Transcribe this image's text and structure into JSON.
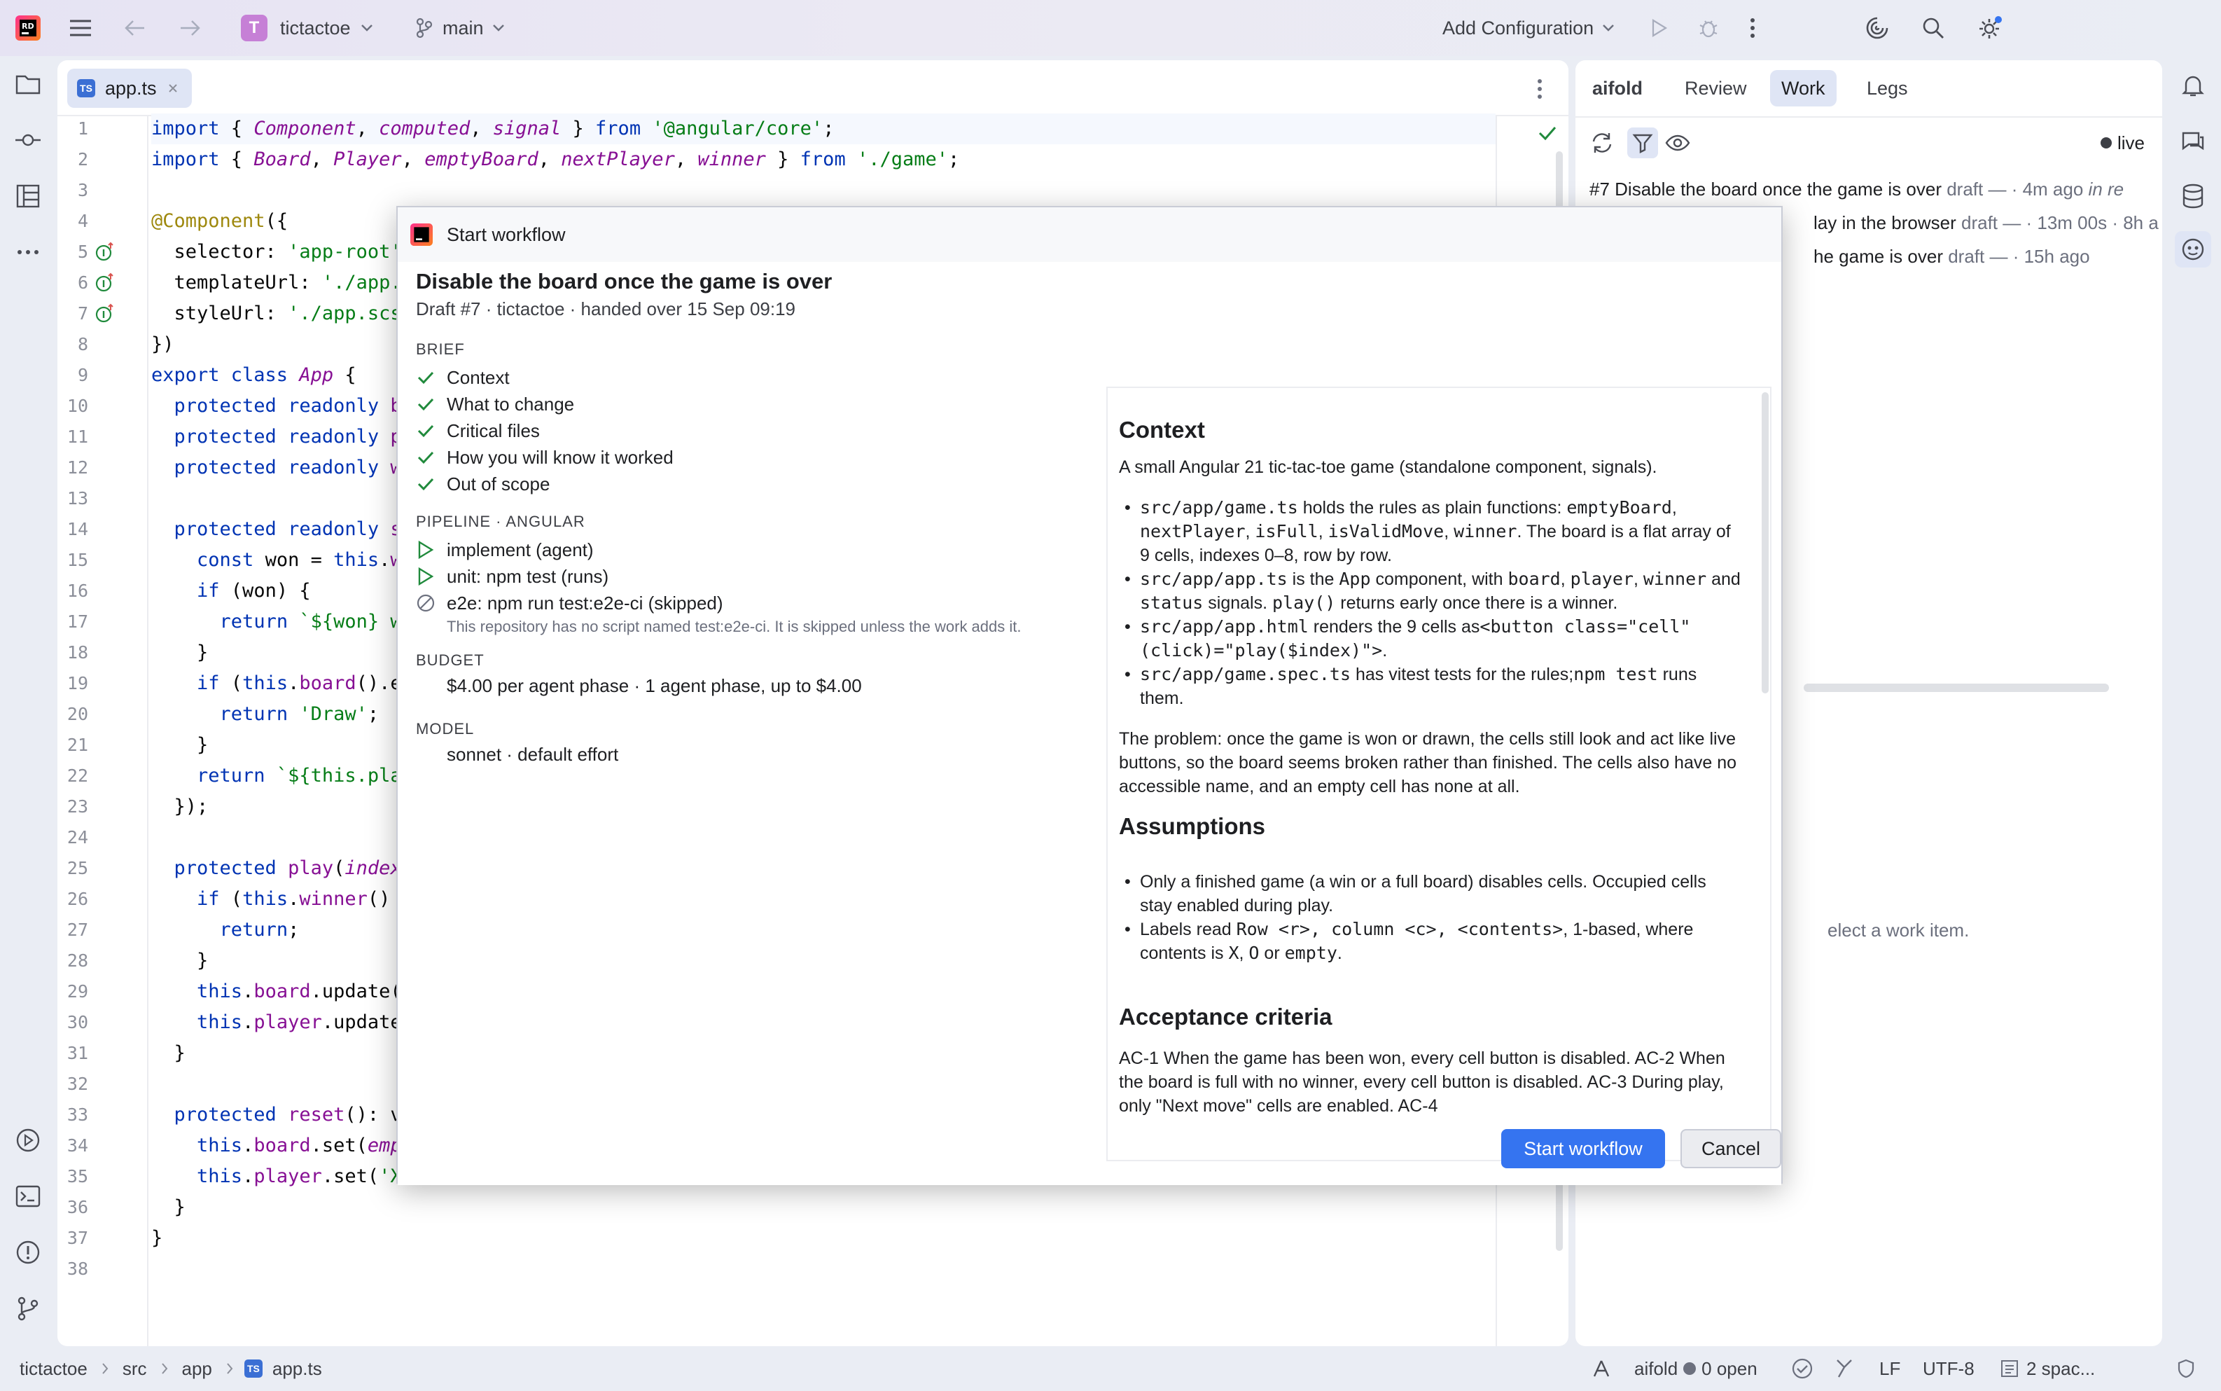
{
  "titlebar": {
    "project_initial": "T",
    "project_name": "tictactoe",
    "branch": "main",
    "run_config": "Add Configuration"
  },
  "editor": {
    "tab_name": "app.ts",
    "lines": [
      {
        "n": "1",
        "html": "<span class='kw'>import</span> { <span class='typ'>Component</span>, <span class='typ'>computed</span>, <span class='typ'>signal</span> } <span class='kw'>from</span> <span class='str'>'@angular/core'</span>;"
      },
      {
        "n": "2",
        "html": "<span class='kw'>import</span> { <span class='typ'>Board</span>, <span class='typ'>Player</span>, <span class='typ'>emptyBoard</span>, <span class='typ'>nextPlayer</span>, <span class='typ'>winner</span> } <span class='kw'>from</span> <span class='str'>'./game'</span>;"
      },
      {
        "n": "3",
        "html": ""
      },
      {
        "n": "4",
        "html": "<span class='ann'>@Component</span>({"
      },
      {
        "n": "5",
        "html": "  selector: <span class='str'>'app-root'</span>,"
      },
      {
        "n": "6",
        "html": "  templateUrl: <span class='str'>'./app.html'</span>,"
      },
      {
        "n": "7",
        "html": "  styleUrl: <span class='str'>'./app.scss'</span>"
      },
      {
        "n": "8",
        "html": "})"
      },
      {
        "n": "9",
        "html": "<span class='kw'>export class</span> <span class='typ'>App</span> {"
      },
      {
        "n": "10",
        "html": "  <span class='kw'>protected readonly</span> <span class='prop'>board</span>"
      },
      {
        "n": "11",
        "html": "  <span class='kw'>protected readonly</span> <span class='prop'>player</span>"
      },
      {
        "n": "12",
        "html": "  <span class='kw'>protected readonly</span> <span class='prop'>winner</span>"
      },
      {
        "n": "13",
        "html": ""
      },
      {
        "n": "14",
        "html": "  <span class='kw'>protected readonly</span> <span class='prop'>status</span>"
      },
      {
        "n": "15",
        "html": "    <span class='kw'>const</span> won = <span class='kw'>this</span>.<span class='prop'>winner</span>();"
      },
      {
        "n": "16",
        "html": "    <span class='kw'>if</span> (won) {"
      },
      {
        "n": "17",
        "html": "      <span class='kw'>return</span> <span class='str'>`${won} wins`</span>;"
      },
      {
        "n": "18",
        "html": "    }"
      },
      {
        "n": "19",
        "html": "    <span class='kw'>if</span> (<span class='kw'>this</span>.<span class='prop'>board</span>().every"
      },
      {
        "n": "20",
        "html": "      <span class='kw'>return</span> <span class='str'>'Draw'</span>;"
      },
      {
        "n": "21",
        "html": "    }"
      },
      {
        "n": "22",
        "html": "    <span class='kw'>return</span> <span class='str'>`${this.player()}`</span>"
      },
      {
        "n": "23",
        "html": "  });"
      },
      {
        "n": "24",
        "html": ""
      },
      {
        "n": "25",
        "html": "  <span class='kw'>protected</span> <span class='prop'>play</span>(<span class='typ'>index</span>"
      },
      {
        "n": "26",
        "html": "    <span class='kw'>if</span> (<span class='kw'>this</span>.<span class='prop'>winner</span>()"
      },
      {
        "n": "27",
        "html": "      <span class='kw'>return</span>;"
      },
      {
        "n": "28",
        "html": "    }"
      },
      {
        "n": "29",
        "html": "    <span class='kw'>this</span>.<span class='prop'>board</span>.update("
      },
      {
        "n": "30",
        "html": "    <span class='kw'>this</span>.<span class='prop'>player</span>.update"
      },
      {
        "n": "31",
        "html": "  }"
      },
      {
        "n": "32",
        "html": ""
      },
      {
        "n": "33",
        "html": "  <span class='kw'>protected</span> <span class='prop'>reset</span>(): void"
      },
      {
        "n": "34",
        "html": "    <span class='kw'>this</span>.<span class='prop'>board</span>.set(<span class='typ'>emptyBoard</span>"
      },
      {
        "n": "35",
        "html": "    <span class='kw'>this</span>.<span class='prop'>player</span>.set(<span class='str'>'X'</span>);"
      },
      {
        "n": "36",
        "html": "  }"
      },
      {
        "n": "37",
        "html": "}"
      },
      {
        "n": "38",
        "html": ""
      }
    ]
  },
  "aipanel": {
    "tabs": [
      "aifold",
      "Review",
      "Work",
      "Legs"
    ],
    "live_label": "live",
    "items": [
      {
        "title": "#7 Disable the board once the game is over",
        "status": "draft",
        "meta": "— · 4m ago",
        "extra": "in re"
      },
      {
        "title": "lay in the browser",
        "status": "draft",
        "meta": "— · 13m 00s · 8h a",
        "extra": ""
      },
      {
        "title": "he game is over",
        "status": "draft",
        "meta": "— · 15h ago",
        "extra": ""
      }
    ],
    "empty_hint": "elect a work item."
  },
  "modal": {
    "window_title": "Start workflow",
    "heading": "Disable the board once the game is over",
    "subheading": "Draft #7 · tictactoe · handed over 15 Sep 09:19",
    "brief_label": "BRIEF",
    "brief_items": [
      "Context",
      "What to change",
      "Critical files",
      "How you will know it worked",
      "Out of scope"
    ],
    "pipeline_label": "PIPELINE · ANGULAR",
    "pipeline_items": [
      "implement (agent)",
      "unit: npm test (runs)",
      "e2e: npm run test:e2e-ci (skipped)"
    ],
    "pipeline_note": "This repository has no script named test:e2e-ci. It is skipped unless the work adds it.",
    "budget_label": "BUDGET",
    "budget_value": "$4.00 per agent phase · 1 agent phase, up to $4.00",
    "model_label": "MODEL",
    "model_value": "sonnet · default effort",
    "start_button": "Start workflow",
    "cancel_button": "Cancel",
    "doc": {
      "context_h": "Context",
      "context_p": "A small Angular 21 tic-tac-toe game (standalone component, signals).",
      "bullets1": [
        {
          "html": "<code>src/app/game.ts</code> holds the rules as plain functions: <code>emptyBoard</code>, <code>nextPlayer</code>, <code>isFull</code>, <code>isValidMove</code>, <code>winner</code>. The board is a flat array of 9 cells, indexes 0–8, row by row."
        },
        {
          "html": "<code>src/app/app.ts</code> is the <code>App</code> component, with <code>board</code>, <code>player</code>, <code>winner</code> and <code>status</code> signals. <code>play()</code> returns early once there is a winner."
        },
        {
          "html": "<code>src/app/app.html</code> renders the 9 cells as<code>&lt;button class=\"cell\" (click)=\"play($index)\"&gt;</code>."
        },
        {
          "html": "<code>src/app/game.spec.ts</code> has vitest tests for the rules;<code>npm test</code> runs them."
        }
      ],
      "problem_p": "The problem: once the game is won or drawn, the cells still look and act like live buttons, so the board seems broken rather than finished. The cells also have no accessible name, and an empty cell has none at all.",
      "assumptions_h": "Assumptions",
      "bullets2": [
        {
          "html": "Only a finished game (a win or a full board) disables cells. Occupied cells stay enabled during play."
        },
        {
          "html": "Labels read <code>Row &lt;r&gt;, column &lt;c&gt;, &lt;contents&gt;</code>, 1-based, where contents is <code>X</code>, <code>O</code> or <code>empty</code>."
        }
      ],
      "acceptance_h": "Acceptance criteria",
      "acceptance_p": "AC-1 When the game has been won, every cell button is disabled. AC-2 When the board is full with no winner, every cell button is disabled. AC-3 During play, only \"Next move\" cells are enabled. AC-4"
    }
  },
  "statusbar": {
    "crumbs": [
      "tictactoe",
      "src",
      "app",
      "app.ts"
    ],
    "aifold": "aifold",
    "open": "0 open",
    "line_sep": "LF",
    "encoding": "UTF-8",
    "indent": "2 spac..."
  },
  "colors": {
    "accent": "#3574f0",
    "check": "#208a3c",
    "badge": "#c680d6"
  }
}
